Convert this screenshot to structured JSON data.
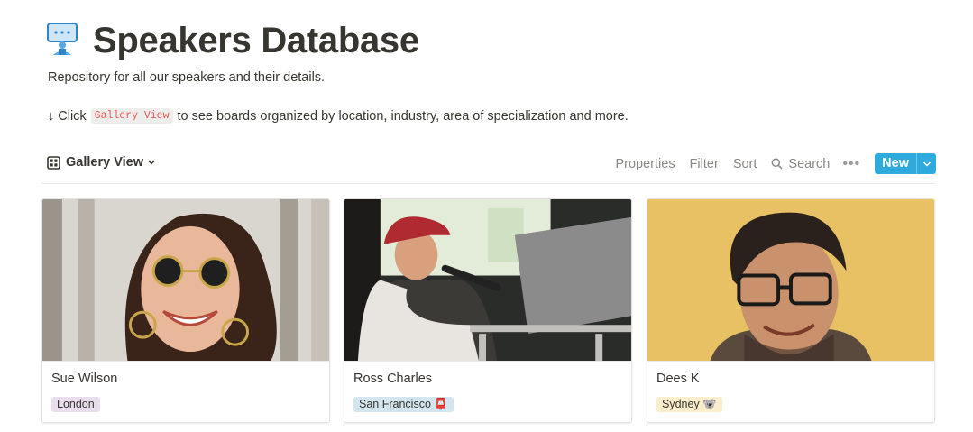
{
  "page": {
    "icon": "presenter-icon",
    "title": "Speakers Database",
    "description": "Repository for all our speakers and their details.",
    "hint_arrow": "↓",
    "hint_click": "Click",
    "hint_code": "Gallery View",
    "hint_rest": "to see boards organized by location, industry, area of specialization and more."
  },
  "toolbar": {
    "view_label": "Gallery View",
    "view_icon": "grid-icon",
    "properties": "Properties",
    "filter": "Filter",
    "sort": "Sort",
    "search": "Search",
    "more": "•••",
    "new_label": "New",
    "accent_color": "#2eaadc"
  },
  "cards": [
    {
      "name": "Sue Wilson",
      "location": "London",
      "tag_color": "#e8deee"
    },
    {
      "name": "Ross Charles",
      "location": "San Francisco 📮",
      "tag_color": "#d3e5ef"
    },
    {
      "name": "Dees K",
      "location": "Sydney 🐨",
      "tag_color": "#fbeecc"
    }
  ]
}
